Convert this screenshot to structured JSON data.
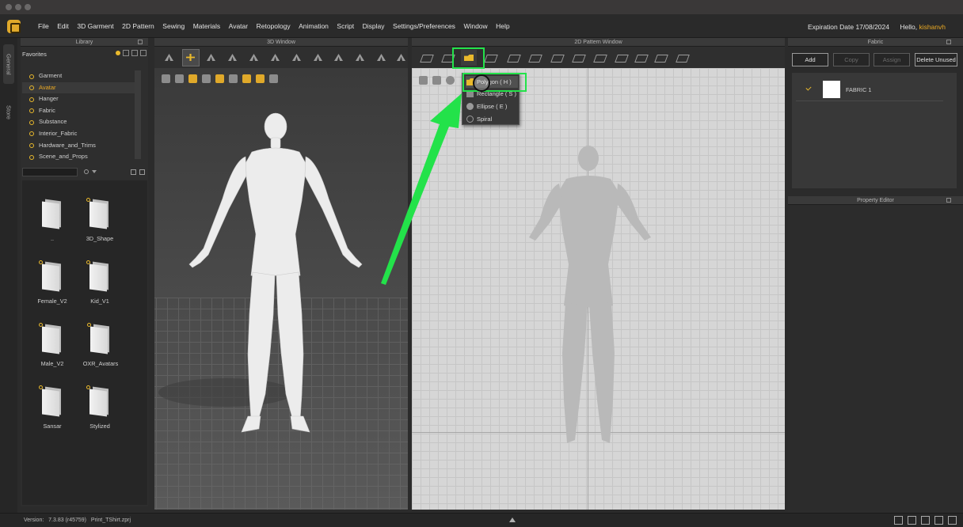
{
  "menu": {
    "items": [
      "File",
      "Edit",
      "3D Garment",
      "2D Pattern",
      "Sewing",
      "Materials",
      "Avatar",
      "Retopology",
      "Animation",
      "Script",
      "Display",
      "Settings/Preferences",
      "Window",
      "Help"
    ],
    "expiration": "Expiration Date 17/08/2024",
    "hello": "Hello,",
    "username": "kishanvh"
  },
  "side_tabs": [
    "General",
    "Store"
  ],
  "library": {
    "title": "Library",
    "favorites_label": "Favorites",
    "tree": [
      {
        "label": "Garment",
        "selected": false
      },
      {
        "label": "Avatar",
        "selected": true
      },
      {
        "label": "Hanger",
        "selected": false
      },
      {
        "label": "Fabric",
        "selected": false
      },
      {
        "label": "Substance",
        "selected": false
      },
      {
        "label": "Interior_Fabric",
        "selected": false
      },
      {
        "label": "Hardware_and_Trims",
        "selected": false
      },
      {
        "label": "Scene_and_Props",
        "selected": false
      }
    ],
    "folders": [
      {
        "label": "..",
        "pinned": false
      },
      {
        "label": "3D_Shape",
        "pinned": true
      },
      {
        "label": "Female_V2",
        "pinned": true
      },
      {
        "label": "Kid_V1",
        "pinned": true
      },
      {
        "label": "Male_V2",
        "pinned": true
      },
      {
        "label": "OXR_Avatars",
        "pinned": true
      },
      {
        "label": "Sansar",
        "pinned": true
      },
      {
        "label": "Stylized",
        "pinned": true
      }
    ]
  },
  "window3d": {
    "title": "3D Window"
  },
  "window2d": {
    "title": "2D Pattern Window",
    "dropdown": [
      {
        "label": "Polygon ( H )",
        "icon": "polygon-icon",
        "active": true
      },
      {
        "label": "Rectangle ( S )",
        "icon": "rectangle-icon",
        "active": false
      },
      {
        "label": "Ellipse ( E )",
        "icon": "ellipse-icon",
        "active": false
      },
      {
        "label": "Spiral",
        "icon": "spiral-icon",
        "active": false
      }
    ]
  },
  "fabric": {
    "title": "Fabric",
    "buttons": {
      "add": "Add",
      "copy": "Copy",
      "assign": "Assign",
      "delete_unused": "Delete Unused"
    },
    "items": [
      {
        "name": "FABRIC 1",
        "color": "#ffffff"
      }
    ]
  },
  "property_editor": {
    "title": "Property Editor"
  },
  "status": {
    "version_label": "Version:",
    "version": "7.3.83 (r45759)",
    "file": "Print_TShirt.zprj"
  },
  "colors": {
    "accent": "#e9a823",
    "highlight": "#23e24a"
  }
}
